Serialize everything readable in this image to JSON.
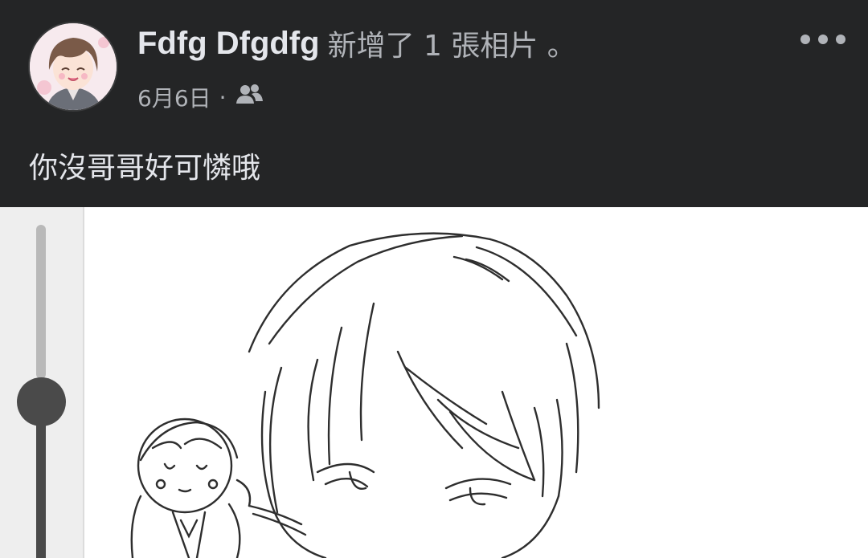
{
  "post": {
    "author": "Fdfg Dfgdfg",
    "action": "新增了 1 張相片 。",
    "date": "6月6日",
    "separator": "·",
    "audience_icon": "friends-icon",
    "more_icon": "more-horizontal-icon",
    "caption": "你沒哥哥好可憐哦"
  },
  "editor": {
    "brush_size": {
      "level": 0.55,
      "orientation": "vertical"
    }
  },
  "colors": {
    "background": "#242526",
    "primary_text": "#e4e6eb",
    "secondary_text": "#b0b3b8",
    "canvas": "#ffffff",
    "slider": "#4a4a4a"
  }
}
